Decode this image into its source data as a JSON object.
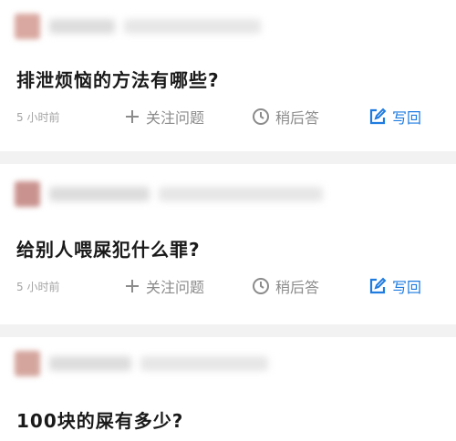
{
  "colors": {
    "page_bg": "#f2f2f2",
    "card_bg": "#ffffff",
    "question_text": "#1a1a1a",
    "meta_text": "#9a9a9a",
    "action_text": "#8b8b8b",
    "answer_accent": "#1e7be0"
  },
  "questions": [
    {
      "title": "排泄烦恼的方法有哪些?",
      "time": "5 小时前",
      "actions": {
        "follow": {
          "label": "关注问题",
          "icon": "plus-icon"
        },
        "later": {
          "label": "稍后答",
          "icon": "clock-icon"
        },
        "answer": {
          "label": "写回",
          "icon": "edit-icon"
        }
      }
    },
    {
      "title": "给别人喂屎犯什么罪?",
      "time": "5 小时前",
      "actions": {
        "follow": {
          "label": "关注问题",
          "icon": "plus-icon"
        },
        "later": {
          "label": "稍后答",
          "icon": "clock-icon"
        },
        "answer": {
          "label": "写回",
          "icon": "edit-icon"
        }
      }
    },
    {
      "title": "100块的屎有多少?"
    }
  ]
}
